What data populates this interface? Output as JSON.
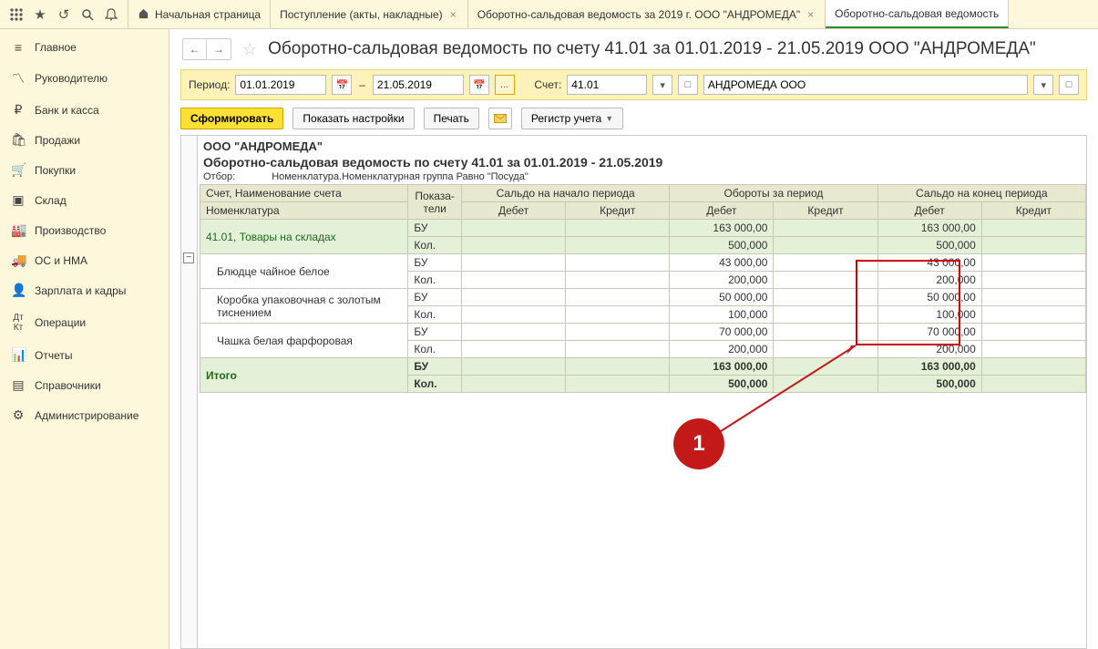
{
  "tabs": {
    "home": "Начальная страница",
    "t1": "Поступление (акты, накладные)",
    "t2": "Оборотно-сальдовая ведомость за 2019 г. ООО \"АНДРОМЕДА\"",
    "t3": "Оборотно-сальдовая ведомость"
  },
  "sidebar": {
    "main": "Главное",
    "manager": "Руководителю",
    "bank": "Банк и касса",
    "sales": "Продажи",
    "purchases": "Покупки",
    "warehouse": "Склад",
    "production": "Производство",
    "assets": "ОС и НМА",
    "payroll": "Зарплата и кадры",
    "operations": "Операции",
    "reports": "Отчеты",
    "reference": "Справочники",
    "admin": "Администрирование"
  },
  "page": {
    "title": "Оборотно-сальдовая ведомость по счету 41.01 за 01.01.2019 - 21.05.2019 ООО \"АНДРОМЕДА\""
  },
  "params": {
    "period_label": "Период:",
    "date_from": "01.01.2019",
    "date_to": "21.05.2019",
    "dots": "...",
    "account_label": "Счет:",
    "account": "41.01",
    "org": "АНДРОМЕДА ООО"
  },
  "actions": {
    "generate": "Сформировать",
    "settings": "Показать настройки",
    "print": "Печать",
    "register": "Регистр учета"
  },
  "report": {
    "org": "ООО \"АНДРОМЕДА\"",
    "title": "Оборотно-сальдовая ведомость по счету 41.01 за 01.01.2019 - 21.05.2019",
    "filter_label": "Отбор:",
    "filter_value": "Номенклатура.Номенклатурная группа Равно \"Посуда\"",
    "col_acct": "Счет, Наименование счета",
    "col_nomen": "Номенклатура",
    "col_ind": "Показа-\nтели",
    "col_start": "Сальдо на начало периода",
    "col_turn": "Обороты за период",
    "col_end": "Сальдо на конец периода",
    "col_debit": "Дебет",
    "col_credit": "Кредит",
    "ind_bu": "БУ",
    "ind_qty": "Кол.",
    "acct_name": "41.01, Товары на складах",
    "item1": "Блюдце чайное белое",
    "item2": "Коробка упаковочная с золотым тиснением",
    "item3": "Чашка белая фарфоровая",
    "total": "Итого",
    "v_163": "163 000,00",
    "v_500": "500,000",
    "v_43": "43 000,00",
    "v_200": "200,000",
    "v_50": "50 000,00",
    "v_100": "100,000",
    "v_70": "70 000,00"
  },
  "callout": {
    "num": "1"
  }
}
